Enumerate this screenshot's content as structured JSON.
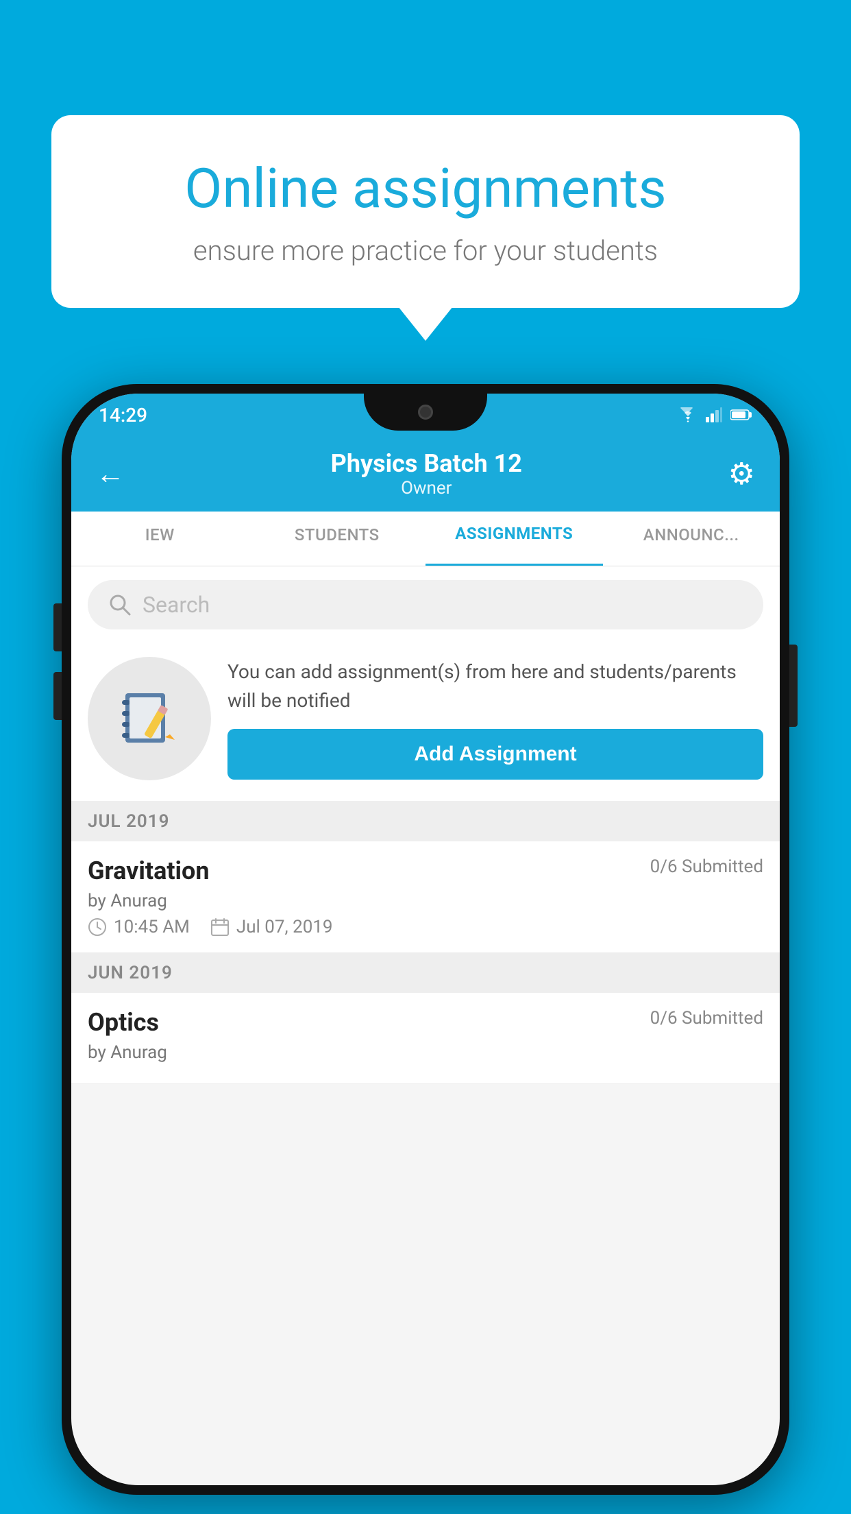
{
  "background": {
    "color": "#00AADD"
  },
  "speech_bubble": {
    "title": "Online assignments",
    "subtitle": "ensure more practice for your students"
  },
  "phone": {
    "status_bar": {
      "time": "14:29",
      "icons": [
        "wifi",
        "signal",
        "battery"
      ]
    },
    "app_bar": {
      "back_icon": "←",
      "title": "Physics Batch 12",
      "subtitle": "Owner",
      "settings_icon": "⚙"
    },
    "tabs": [
      {
        "label": "IEW",
        "active": false
      },
      {
        "label": "STUDENTS",
        "active": false
      },
      {
        "label": "ASSIGNMENTS",
        "active": true
      },
      {
        "label": "ANNOUNCEMENTS",
        "active": false
      }
    ],
    "search": {
      "placeholder": "Search"
    },
    "promo": {
      "description": "You can add assignment(s) from here and students/parents will be notified",
      "button_label": "Add Assignment"
    },
    "sections": [
      {
        "month": "JUL 2019",
        "assignments": [
          {
            "title": "Gravitation",
            "submitted": "0/6 Submitted",
            "by": "by Anurag",
            "time": "10:45 AM",
            "date": "Jul 07, 2019"
          }
        ]
      },
      {
        "month": "JUN 2019",
        "assignments": [
          {
            "title": "Optics",
            "submitted": "0/6 Submitted",
            "by": "by Anurag",
            "time": "",
            "date": ""
          }
        ]
      }
    ]
  }
}
